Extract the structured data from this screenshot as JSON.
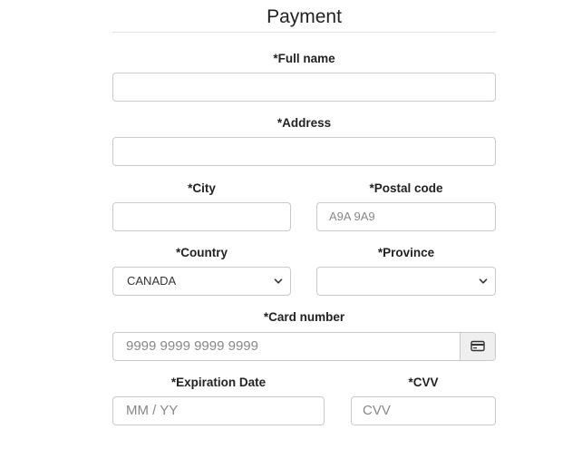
{
  "form": {
    "title": "Payment",
    "full_name_label": "*Full name",
    "address_label": "*Address",
    "city_label": "*City",
    "postal_code_label": "*Postal code",
    "postal_code_placeholder": "A9A 9A9",
    "country_label": "*Country",
    "country_selected": "CANADA",
    "province_label": "*Province",
    "province_selected": "",
    "card_number_label": "*Card number",
    "card_number_placeholder": "9999 9999 9999 9999",
    "expiration_label": "*Expiration Date",
    "expiration_placeholder": "MM / YY",
    "cvv_label": "*CVV",
    "cvv_placeholder": "CVV"
  },
  "icons": {
    "select_chevron": "chevron-down-icon",
    "card": "credit-card-icon"
  }
}
